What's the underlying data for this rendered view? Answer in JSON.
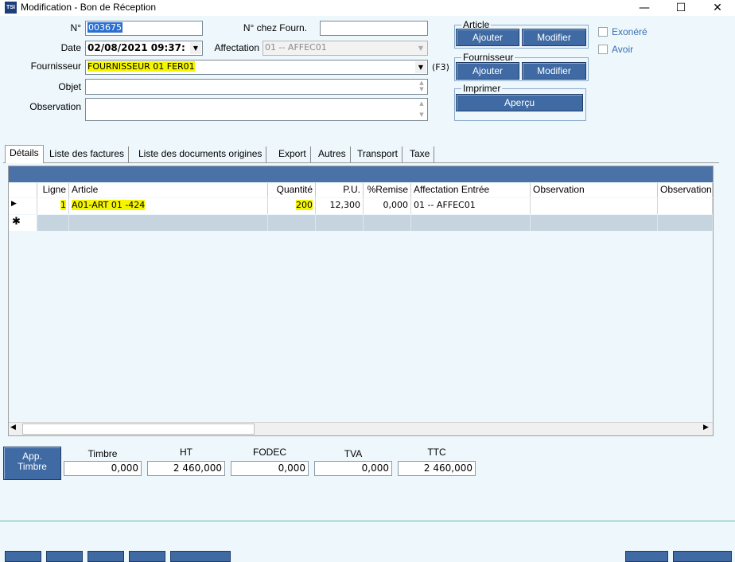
{
  "window": {
    "icon_text": "TSI",
    "title": "Modification - Bon de Réception",
    "minimize": "—",
    "maximize": "☐",
    "close": "✕"
  },
  "form": {
    "no_label": "N°",
    "no_value": "003675",
    "no_fourn_label": "N° chez Fourn.",
    "no_fourn_value": "",
    "date_label": "Date",
    "date_value": "02/08/2021 09:37:",
    "affectation_label": "Affectation",
    "affectation_value": "01 -- AFFEC01",
    "fournisseur_label": "Fournisseur",
    "fournisseur_value": "FOURNISSEUR 01 FER01",
    "f3_hint": "(F3)",
    "objet_label": "Objet",
    "objet_value": "",
    "observation_label": "Observation",
    "observation_value": ""
  },
  "groups": {
    "article": {
      "title": "Article",
      "add": "Ajouter",
      "edit": "Modifier"
    },
    "fournisseur": {
      "title": "Fournisseur",
      "add": "Ajouter",
      "edit": "Modifier"
    },
    "imprimer": {
      "title": "Imprimer",
      "preview": "Aperçu"
    }
  },
  "checkboxes": {
    "exonere": "Exonéré",
    "avoir": "Avoir"
  },
  "tabs": [
    "Détails",
    "Liste des factures",
    "Liste des documents origines",
    "Export",
    "Autres",
    "Transport",
    "Taxe"
  ],
  "grid": {
    "columns": [
      "Ligne",
      "Article",
      "Quantité",
      "P.U.",
      "%Remise",
      "Affectation Entrée",
      "Observation",
      "Observation"
    ],
    "rows": [
      {
        "indicator": "▶",
        "ligne": "1",
        "article": "A01-ART 01 -424",
        "quantite": "200",
        "pu": "12,300",
        "remise": "0,000",
        "affectation": "01 -- AFFEC01",
        "obs1": "",
        "obs2": ""
      }
    ],
    "new_row_indicator": "✱",
    "scroll_left": "◀",
    "scroll_right": "▶"
  },
  "totals": {
    "app_timbre": "App.\nTimbre",
    "timbre_label": "Timbre",
    "timbre_value": "0,000",
    "ht_label": "HT",
    "ht_value": "2 460,000",
    "fodec_label": "FODEC",
    "fodec_value": "0,000",
    "tva_label": "TVA",
    "tva_value": "0,000",
    "ttc_label": "TTC",
    "ttc_value": "2 460,000"
  },
  "colors": {
    "accent": "#3f6aa3",
    "highlight": "#f6f500",
    "grid_header": "#4a72a6"
  }
}
